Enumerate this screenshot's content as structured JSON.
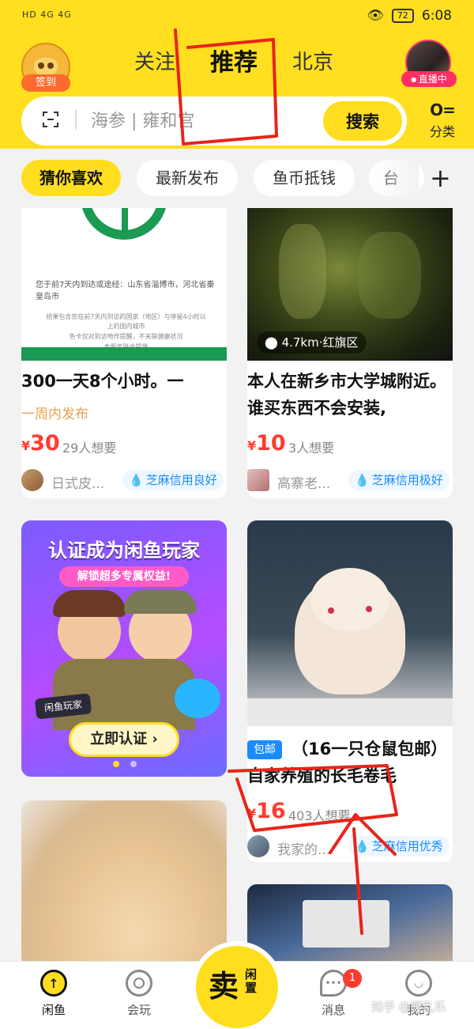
{
  "status_bar": {
    "left": "HD 4G 4G",
    "battery": "72",
    "time": "6:08"
  },
  "header": {
    "checkin_label": "签到",
    "tabs": [
      {
        "label": "关注",
        "active": false
      },
      {
        "label": "推荐",
        "active": true
      },
      {
        "label": "北京",
        "active": false
      }
    ],
    "live_label": "直播中"
  },
  "search": {
    "placeholder": "海参 | 雍和宫",
    "button_label": "搜索",
    "category_label": "分类",
    "category_icon": "O="
  },
  "chips": [
    {
      "label": "猜你喜欢",
      "active": true
    },
    {
      "label": "最新发布",
      "active": false
    },
    {
      "label": "鱼币抵钱",
      "active": false
    },
    {
      "label": "台",
      "active": false
    }
  ],
  "chips_plus": "+",
  "feed": {
    "card1": {
      "image_text_1": "您于前7天内到达或途经：山东省淄博市，河北省秦皇岛市",
      "image_text_2": "结果包含您在前7天内到访的国家（地区）与停留4小时以上的国内城市",
      "image_text_3": "色卡仅对到访地作提醒，不关联健康状况",
      "image_text_4": "本服务联合提供",
      "title": "300一天8个小时。一",
      "subtitle": "一周内发布",
      "price_symbol": "¥",
      "price": "30",
      "wants": "29人想要",
      "seller": "日式皮...",
      "credit": "芝麻信用良好"
    },
    "card2": {
      "location": "4.7km·红旗区",
      "title": "本人在新乡市大学城附近。谁买东西不会安装,",
      "price_symbol": "¥",
      "price": "10",
      "wants": "3人想要",
      "seller": "高寨老...",
      "credit": "芝麻信用极好"
    },
    "promo": {
      "title": "认证成为闲鱼玩家",
      "subtitle": "解锁超多专属权益!",
      "badge": "闲鱼玩家",
      "button": "立即认证 ›"
    },
    "card3": {
      "tag": "包邮",
      "title": "（16一只仓鼠包邮）自家养殖的长毛卷毛",
      "price_symbol": "¥",
      "price": "16",
      "wants": "403人想要",
      "seller": "我家的...",
      "credit": "芝麻信用优秀"
    }
  },
  "bottom_nav": {
    "items": [
      {
        "label": "闲鱼"
      },
      {
        "label": "会玩"
      },
      {
        "label": "消息"
      },
      {
        "label": "我的"
      }
    ],
    "sell_main": "卖",
    "sell_sub": "闲置",
    "message_badge": "1"
  },
  "watermark": "知乎 @暖乱乐",
  "colors": {
    "brand_yellow": "#ffdf1f",
    "price_red": "#ff3b30",
    "credit_blue": "#1a8cff",
    "annotation_red": "#e8241a"
  }
}
